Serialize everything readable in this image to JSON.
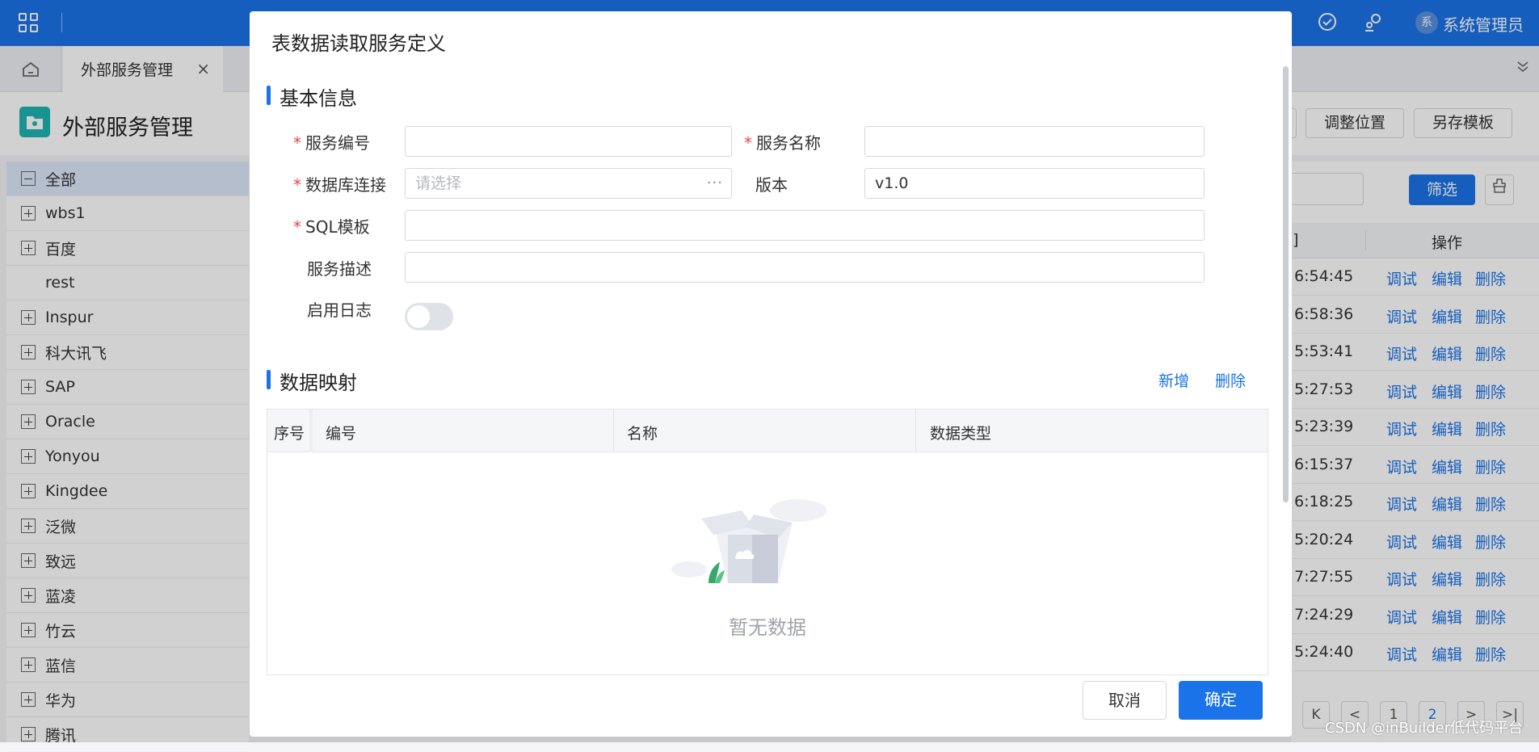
{
  "topbar": {
    "user_avatar": "系",
    "user_name": "系统管理员"
  },
  "tabs": {
    "active_tab": "外部服务管理",
    "close": "×"
  },
  "page": {
    "title": "外部服务管理",
    "buttons": [
      "调整位置",
      "另存模板"
    ]
  },
  "tree": [
    {
      "label": "全部",
      "toggle": "minus",
      "selected": true
    },
    {
      "label": "wbs1",
      "toggle": "plus"
    },
    {
      "label": "百度",
      "toggle": "plus"
    },
    {
      "label": "rest",
      "toggle": "none"
    },
    {
      "label": "Inspur",
      "toggle": "plus"
    },
    {
      "label": "科大讯飞",
      "toggle": "plus"
    },
    {
      "label": "SAP",
      "toggle": "plus"
    },
    {
      "label": "Oracle",
      "toggle": "plus"
    },
    {
      "label": "Yonyou",
      "toggle": "plus"
    },
    {
      "label": "Kingdee",
      "toggle": "plus"
    },
    {
      "label": "泛微",
      "toggle": "plus"
    },
    {
      "label": "致远",
      "toggle": "plus"
    },
    {
      "label": "蓝凌",
      "toggle": "plus"
    },
    {
      "label": "竹云",
      "toggle": "plus"
    },
    {
      "label": "蓝信",
      "toggle": "plus"
    },
    {
      "label": "华为",
      "toggle": "plus"
    },
    {
      "label": "腾讯",
      "toggle": "plus"
    }
  ],
  "list": {
    "filter_label": "筛选",
    "col_time": "]",
    "col_ops": "操作",
    "actions": [
      "调试",
      "编辑",
      "删除"
    ],
    "times": [
      "6:54:45",
      "6:58:36",
      "5:53:41",
      "5:27:53",
      "5:23:39",
      "6:15:37",
      "6:18:25",
      "5:20:24",
      "7:27:55",
      "7:24:29",
      "5:24:40"
    ],
    "pager": [
      "K",
      "<",
      "1",
      "2",
      ">",
      ">|"
    ]
  },
  "modal": {
    "title": "表数据读取服务定义",
    "section_basic": "基本信息",
    "fields": {
      "service_code_label": "服务编号",
      "service_name_label": "服务名称",
      "db_conn_label": "数据库连接",
      "db_conn_placeholder": "请选择",
      "version_label": "版本",
      "version_value": "v1.0",
      "sql_label": "SQL模板",
      "desc_label": "服务描述",
      "log_label": "启用日志",
      "log_enabled": false
    },
    "required_mark": "*",
    "section_mapping": "数据映射",
    "mapping_add": "新增",
    "mapping_delete": "删除",
    "mapping_columns": [
      "序号",
      "编号",
      "名称",
      "数据类型"
    ],
    "empty_text": "暂无数据",
    "cancel": "取消",
    "confirm": "确定"
  },
  "watermark": "CSDN @inBuilder低代码平台",
  "colors": {
    "primary": "#1a73e8",
    "required": "#e5484d"
  }
}
